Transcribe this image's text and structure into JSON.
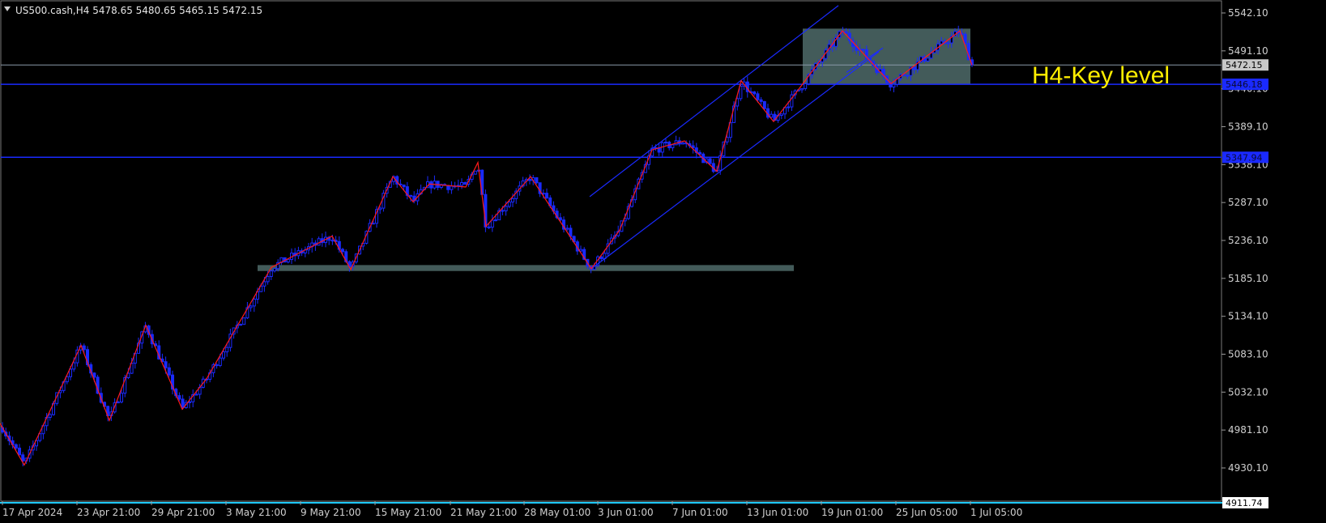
{
  "header": {
    "menu_icon": "triangle-down-icon",
    "symbol_info": "US500.cash,H4  5478.65 5480.65 5465.15 5472.15"
  },
  "annotation": {
    "text": "H4-Key level",
    "color": "#ffee00"
  },
  "price_tags": {
    "current": "5472.15",
    "level_upper": "5446.18",
    "level_mid": "5347.94",
    "bottom": "4911.74"
  },
  "colors": {
    "background": "#000000",
    "candle": "#1a2aff",
    "zigzag": "#ff1a1a",
    "level_line": "#1a2aff",
    "channel": "#1a2aff",
    "zone": "#5a7a78",
    "bottom_line": "#1ec8ff",
    "bid_line": "#8a9aa8"
  },
  "chart_data": {
    "type": "candlestick",
    "title": "US500.cash,H4",
    "ohlc": {
      "open": 5478.65,
      "high": 5480.65,
      "low": 5465.15,
      "close": 5472.15
    },
    "y_ticks": [
      5542.1,
      5491.1,
      5440.1,
      5389.1,
      5338.1,
      5287.1,
      5236.1,
      5185.1,
      5134.1,
      5083.1,
      5032.1,
      4981.1,
      4930.1
    ],
    "y_tick_labels": [
      "5542.10",
      "5491.10",
      "5440.10",
      "5389.10",
      "5338.10",
      "5287.10",
      "5236.10",
      "5185.10",
      "5134.10",
      "5083.10",
      "5032.10",
      "4981.10",
      "4930.10"
    ],
    "x_tick_labels": [
      "17 Apr 2024",
      "23 Apr 21:00",
      "29 Apr 21:00",
      "3 May 21:00",
      "9 May 21:00",
      "15 May 21:00",
      "21 May 21:00",
      "28 May 01:00",
      "3 Jun 01:00",
      "7 Jun 01:00",
      "13 Jun 01:00",
      "19 Jun 01:00",
      "25 Jun 05:00",
      "1 Jul 05:00"
    ],
    "x_range": [
      0,
      1507
    ],
    "ylim": [
      4911.74,
      5558
    ],
    "horizontal_levels": [
      5472.15,
      5446.18,
      5347.94
    ],
    "zigzag": [
      [
        0,
        4990
      ],
      [
        30,
        4934
      ],
      [
        100,
        5095
      ],
      [
        135,
        4994
      ],
      [
        180,
        5122
      ],
      [
        225,
        5009
      ],
      [
        255,
        5050
      ],
      [
        335,
        5200
      ],
      [
        410,
        5242
      ],
      [
        433,
        5197
      ],
      [
        485,
        5322
      ],
      [
        510,
        5288
      ],
      [
        530,
        5312
      ],
      [
        575,
        5308
      ],
      [
        590,
        5341
      ],
      [
        600,
        5255
      ],
      [
        655,
        5322
      ],
      [
        730,
        5198
      ],
      [
        765,
        5250
      ],
      [
        805,
        5358
      ],
      [
        845,
        5370
      ],
      [
        885,
        5329
      ],
      [
        915,
        5451
      ],
      [
        955,
        5396
      ],
      [
        985,
        5438
      ],
      [
        1040,
        5518
      ],
      [
        1100,
        5447
      ],
      [
        1185,
        5518
      ],
      [
        1200,
        5472
      ]
    ],
    "channel_lines": [
      [
        [
          728,
          5295
        ],
        [
          1035,
          5552
        ]
      ],
      [
        [
          730,
          5198
        ],
        [
          1085,
          5490
        ]
      ],
      [
        [
          1045,
          5462
        ],
        [
          1090,
          5495
        ]
      ]
    ],
    "zones": [
      {
        "x": [
          318,
          980
        ],
        "price": [
          5195,
          5203
        ]
      },
      {
        "x": [
          991,
          1198
        ],
        "price": [
          5446.18,
          5521
        ]
      }
    ]
  }
}
